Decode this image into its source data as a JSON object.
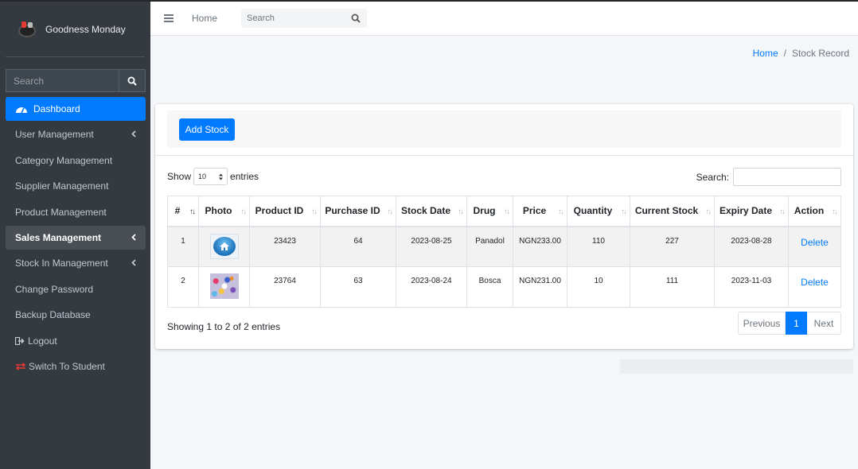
{
  "sidebar": {
    "brand": "Goodness Monday",
    "search_placeholder": "Search",
    "items": [
      {
        "label": "Dashboard"
      },
      {
        "label": "User Management"
      },
      {
        "label": "Category Management"
      },
      {
        "label": "Supplier Management"
      },
      {
        "label": "Product Management"
      },
      {
        "label": "Sales Management"
      },
      {
        "label": "Stock In Management"
      },
      {
        "label": "Change Password"
      },
      {
        "label": "Backup Database"
      },
      {
        "label": "Logout"
      },
      {
        "label": "Switch To Student"
      }
    ]
  },
  "header": {
    "home_link": "Home",
    "search_placeholder": "Search"
  },
  "breadcrumb": {
    "home": "Home",
    "separator": "/",
    "current": "Stock Record"
  },
  "card": {
    "add_button": "Add Stock",
    "show_label": "Show",
    "page_length": "10",
    "entries_label": "entries",
    "search_label": "Search:",
    "columns": [
      "#",
      "Photo",
      "Product ID",
      "Purchase ID",
      "Stock Date",
      "Drug",
      "Price",
      "Quantity",
      "Current Stock",
      "Expiry Date",
      "Action"
    ],
    "rows": [
      {
        "num": "1",
        "photo": "home-icon",
        "product_id": "23423",
        "purchase_id": "64",
        "stock_date": "2023-08-25",
        "drug": "Panadol",
        "price": "NGN233.00",
        "quantity": "110",
        "current_stock": "227",
        "expiry_date": "2023-08-28",
        "action": "Delete"
      },
      {
        "num": "2",
        "photo": "pills-photo",
        "product_id": "23764",
        "purchase_id": "63",
        "stock_date": "2023-08-24",
        "drug": "Bosca",
        "price": "NGN231.00",
        "quantity": "10",
        "current_stock": "111",
        "expiry_date": "2023-11-03",
        "action": "Delete"
      }
    ],
    "info": "Showing 1 to 2 of 2 entries",
    "pagination": {
      "previous": "Previous",
      "current": "1",
      "next": "Next"
    }
  },
  "colors": {
    "sidebar_bg": "#343a40",
    "primary": "#007bff",
    "page_bg": "#f4f6f9"
  }
}
